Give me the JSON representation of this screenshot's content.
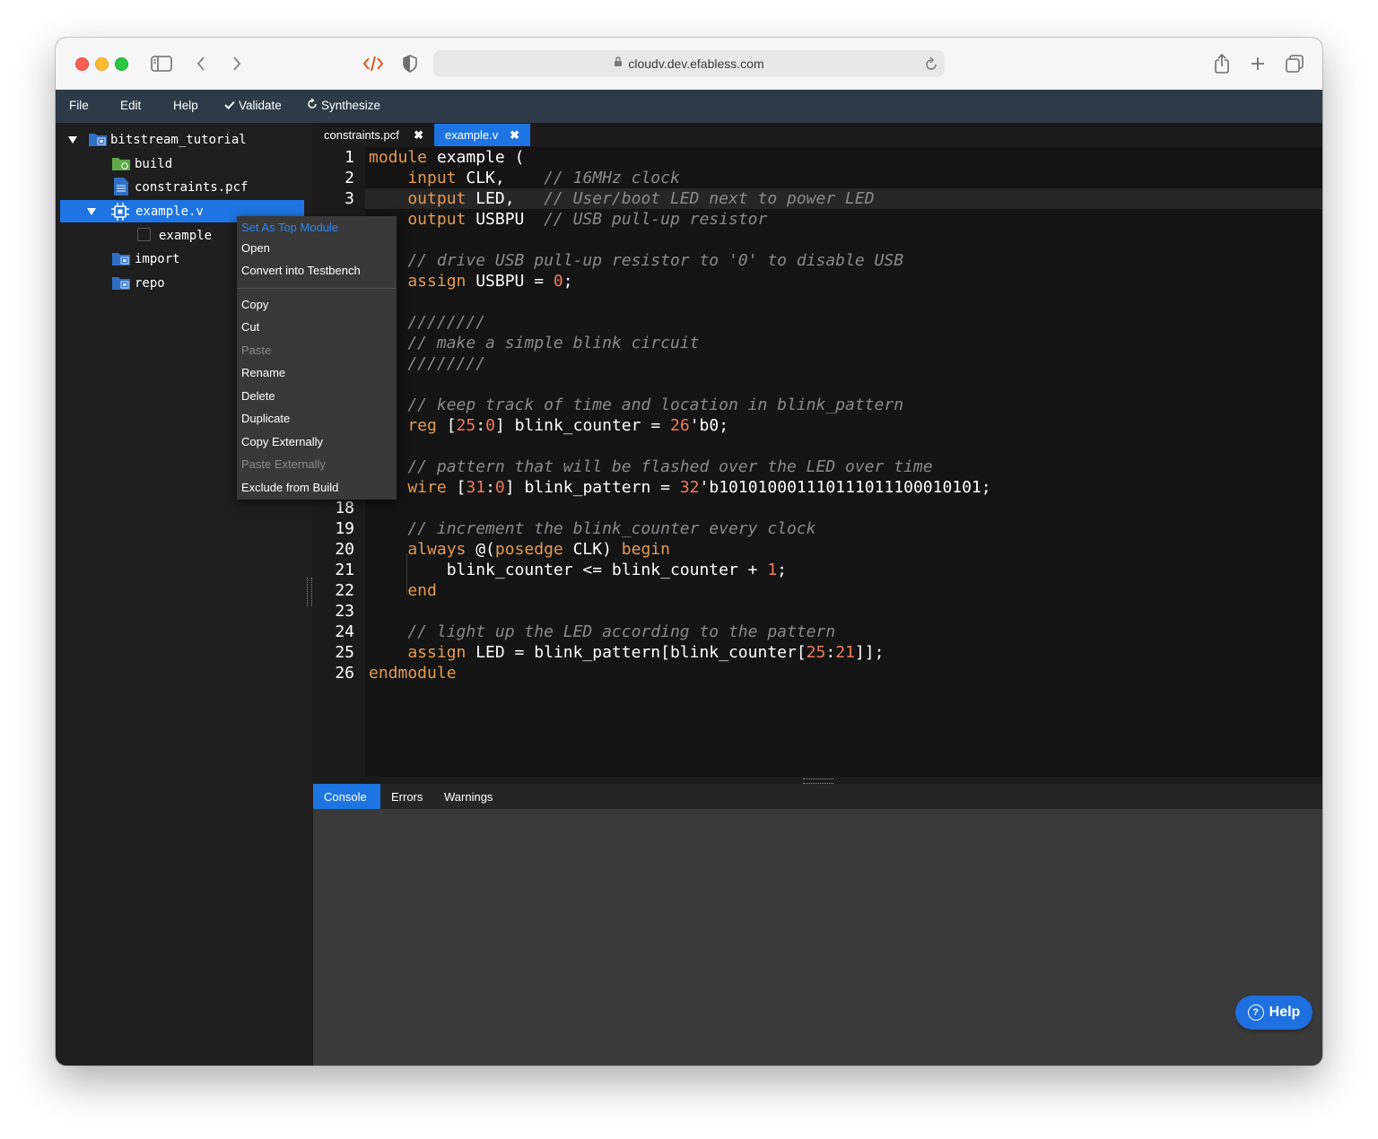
{
  "browser": {
    "url": "cloudv.dev.efabless.com",
    "icons": [
      "sidebar-toggle-icon",
      "back-icon",
      "forward-icon",
      "dev-code-icon",
      "privacy-shield-icon",
      "lock-icon",
      "reload-icon",
      "share-icon",
      "new-tab-icon",
      "tab-overview-icon"
    ]
  },
  "menubar": {
    "file": "File",
    "edit": "Edit",
    "help": "Help",
    "validate": "Validate",
    "synthesize": "Synthesize"
  },
  "tree": {
    "root": "bitstream_tutorial",
    "build": "build",
    "constraints": "constraints.pcf",
    "example_v": "example.v",
    "example_module": "example",
    "import": "import",
    "repo": "repo"
  },
  "context_menu": {
    "set_top": "Set As Top Module",
    "open": "Open",
    "convert": "Convert into Testbench",
    "copy": "Copy",
    "cut": "Cut",
    "paste": "Paste",
    "rename": "Rename",
    "delete": "Delete",
    "duplicate": "Duplicate",
    "copy_ext": "Copy Externally",
    "paste_ext": "Paste Externally",
    "exclude": "Exclude from Build"
  },
  "tabs": {
    "constraints": "constraints.pcf",
    "example": "example.v",
    "close": "✖"
  },
  "gutter": {
    "n1": "1",
    "n2": "2",
    "n3": "3",
    "n18": "18",
    "n19": "19",
    "n20": "20",
    "n21": "21",
    "n22": "22",
    "n23": "23",
    "n24": "24",
    "n25": "25",
    "n26": "26"
  },
  "code": {
    "l1a": "module",
    "l1b": " example (",
    "l2a": "    input",
    "l2b": " CLK,    ",
    "l2c": "// 16MHz clock",
    "l3a": "    output",
    "l3b": " LED,   ",
    "l3c": "// User/boot LED next to power LED",
    "l4a": "    output",
    "l4b": " USBPU  ",
    "l4c": "// USB pull-up resistor",
    "l6": "    // drive USB pull-up resistor to '0' to disable USB",
    "l7a": "    assign",
    "l7b": " USBPU = ",
    "l7c": "0",
    "l7d": ";",
    "l9": "    ////////",
    "l10": "    // make a simple blink circuit",
    "l11": "    ////////",
    "l13": "    // keep track of time and location in blink_pattern",
    "l14a": "    reg",
    "l14b": " [",
    "l14c": "25",
    "l14d": ":",
    "l14e": "0",
    "l14f": "] blink_counter = ",
    "l14g": "26",
    "l14h": "'b0;",
    "l16": "    // pattern that will be flashed over the LED over time",
    "l17a": "    wire",
    "l17b": " [",
    "l17c": "31",
    "l17d": ":",
    "l17e": "0",
    "l17f": "] blink_pattern = ",
    "l17g": "32",
    "l17h": "'b101010001110111011100010101;",
    "l19": "    // increment the blink_counter every clock",
    "l20a": "    always",
    "l20b": " @(",
    "l20c": "posedge",
    "l20d": " CLK) ",
    "l20e": "begin",
    "l21a": "        blink_counter <= blink_counter + ",
    "l21b": "1",
    "l21c": ";",
    "l22": "    end",
    "l24": "    // light up the LED according to the pattern",
    "l25a": "    assign",
    "l25b": " LED = blink_pattern[blink_counter[",
    "l25c": "25",
    "l25d": ":",
    "l25e": "21",
    "l25f": "]];",
    "l26": "endmodule"
  },
  "panel": {
    "console": "Console",
    "errors": "Errors",
    "warnings": "Warnings"
  },
  "help_button": {
    "label": "Help",
    "icon_glyph": "?"
  },
  "colors": {
    "accent": "#1e74e2",
    "menubar": "#2e3a48",
    "keyword": "#e59b55",
    "comment": "#8a8a8a",
    "number": "#f07b5c"
  }
}
